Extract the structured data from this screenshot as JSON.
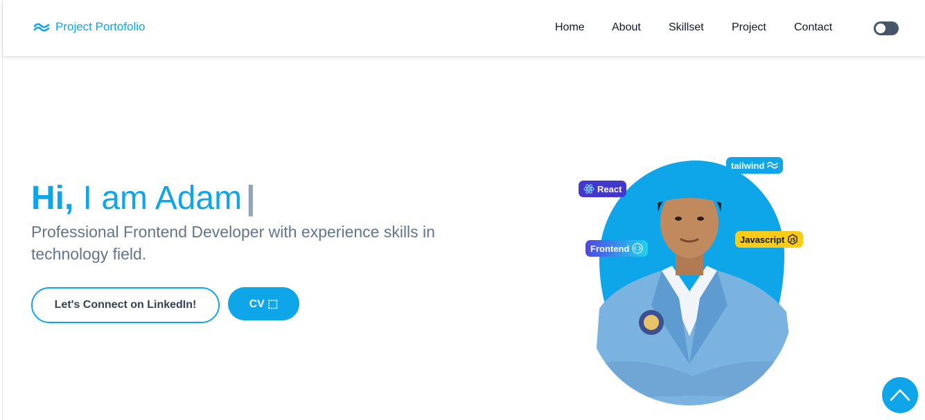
{
  "brand": {
    "name": "Project Portofolio",
    "icon": "tailwind-wave-icon",
    "color": "#0ea5e9"
  },
  "nav": {
    "items": [
      {
        "label": "Home"
      },
      {
        "label": "About"
      },
      {
        "label": "Skillset"
      },
      {
        "label": "Project"
      },
      {
        "label": "Contact"
      }
    ],
    "theme_toggle": {
      "state": "off",
      "icon": "toggle-icon"
    }
  },
  "hero": {
    "greeting": "Hi,",
    "intro": " I am Adam",
    "cursor": "|",
    "description": "Professional Frontend Developer with experience skills in technology field.",
    "buttons": {
      "linkedin": "Let's Connect on LinkedIn!",
      "cv": "CV ⬚"
    }
  },
  "badges": {
    "react": "React",
    "tailwind": "tailwind",
    "frontend": "Frontend",
    "javascript": "Javascript"
  },
  "scroll_top": {
    "icon": "chevron-up-icon"
  },
  "colors": {
    "accent": "#0ea5e9",
    "text_muted": "#64748b",
    "toggle": "#475569"
  }
}
